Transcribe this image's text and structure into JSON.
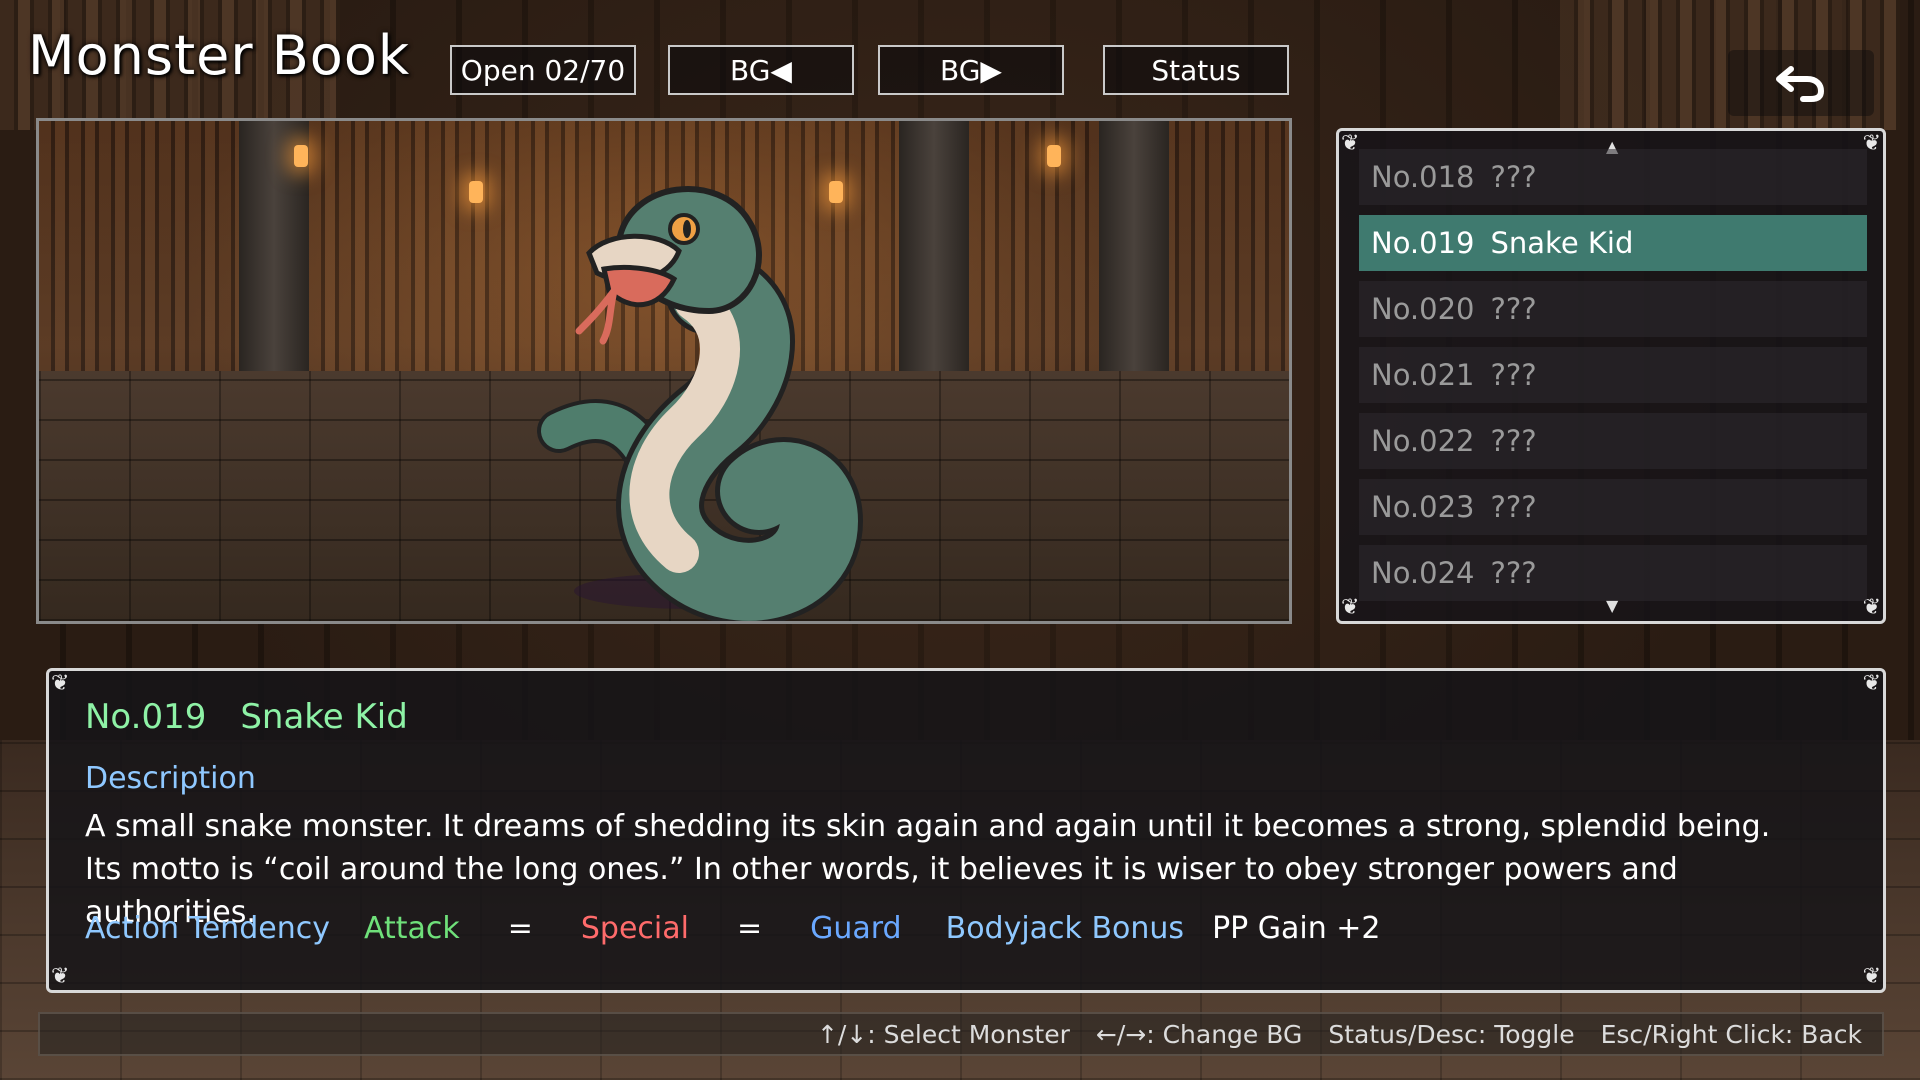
{
  "header": {
    "title": "Monster Book",
    "open_count": "Open 02/70",
    "bg_prev": "BG◀",
    "bg_next": "BG▶",
    "status": "Status",
    "back_icon": "return-arrow-icon"
  },
  "list": {
    "items": [
      {
        "num": "No.018",
        "name": "???",
        "selected": false
      },
      {
        "num": "No.019",
        "name": "Snake Kid",
        "selected": true
      },
      {
        "num": "No.020",
        "name": "???",
        "selected": false
      },
      {
        "num": "No.021",
        "name": "???",
        "selected": false
      },
      {
        "num": "No.022",
        "name": "???",
        "selected": false
      },
      {
        "num": "No.023",
        "name": "???",
        "selected": false
      },
      {
        "num": "No.024",
        "name": "???",
        "selected": false
      }
    ]
  },
  "entry": {
    "number": "No.019",
    "name": "Snake Kid",
    "description_label": "Description",
    "description_line1": "A small snake monster. It dreams of shedding its skin again and again until it becomes a strong, splendid being.",
    "description_line2": "Its motto is “coil around the long ones.” In other words, it believes it is wiser to obey stronger powers and authorities.",
    "action_tendency_label": "Action Tendency",
    "attack": "Attack",
    "eq1": "=",
    "special": "Special",
    "eq2": "=",
    "guard": "Guard",
    "bodyjack_label": "Bodyjack Bonus",
    "bodyjack_value": "PP Gain +2"
  },
  "help": {
    "select": "↑/↓: Select Monster",
    "change_bg": "←/→: Change BG",
    "toggle": "Status/Desc: Toggle",
    "back": "Esc/Right Click: Back"
  },
  "colors": {
    "selected_row": "#3f7a6f",
    "entry_title": "#8ef2a6",
    "label_blue": "#8fc8ff",
    "attack_green": "#6fe07a",
    "special_red": "#ff6b6b",
    "guard_blue": "#6aa8ff"
  }
}
